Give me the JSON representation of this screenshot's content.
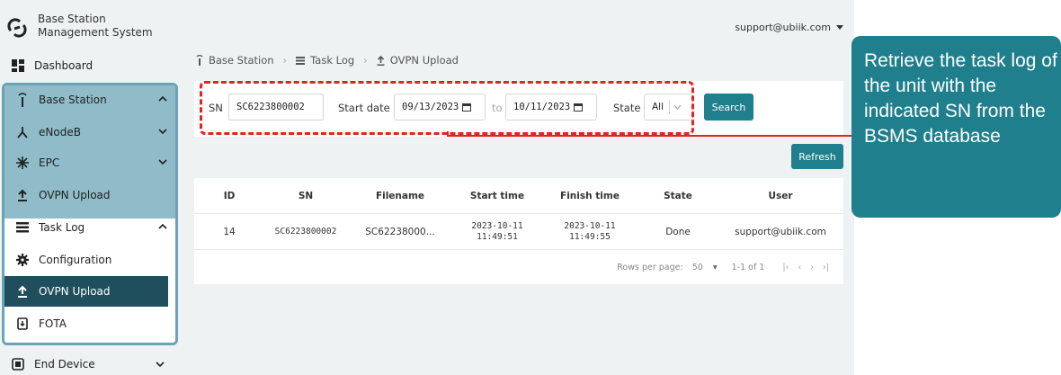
{
  "brand": {
    "title": "Base Station Management System"
  },
  "user": {
    "email": "support@ubiik.com"
  },
  "sidebar": {
    "dashboard": "Dashboard",
    "base_station": "Base Station",
    "enodeb": "eNodeB",
    "epc": "EPC",
    "ovpn_upload": "OVPN Upload",
    "task_log": "Task Log",
    "configuration": "Configuration",
    "ovpn_upload_sub": "OVPN Upload",
    "fota": "FOTA",
    "end_device": "End Device"
  },
  "breadcrumb": {
    "level1": "Base Station",
    "level2": "Task Log",
    "level3": "OVPN Upload"
  },
  "filter": {
    "sn_label": "SN",
    "sn_value": "SC6223800002",
    "start_label": "Start date",
    "start_value": "09/13/2023",
    "to_label": "to",
    "end_value": "10/11/2023",
    "state_label": "State",
    "state_value": "All",
    "search": "Search"
  },
  "refresh": "Refresh",
  "table": {
    "headers": [
      "ID",
      "SN",
      "Filename",
      "Start time",
      "Finish time",
      "State",
      "User"
    ],
    "rows": [
      {
        "id": "14",
        "sn": "SC6223800002",
        "filename": "SC62238000...",
        "start_date": "2023-10-11",
        "start_time": "11:49:51",
        "finish_date": "2023-10-11",
        "finish_time": "11:49:55",
        "state": "Done",
        "user": "support@ubiik.com"
      }
    ],
    "pager": {
      "rows_label": "Rows per page:",
      "rows_value": "50",
      "range": "1-1 of 1"
    }
  },
  "annotation": {
    "text": "Retrieve the task log of  the unit with the indicated SN from the BSMS database"
  },
  "colors": {
    "accent": "#1f7f8c",
    "highlight": "#e52222",
    "active": "#1f4f5c",
    "group": "#8fbcc8"
  }
}
